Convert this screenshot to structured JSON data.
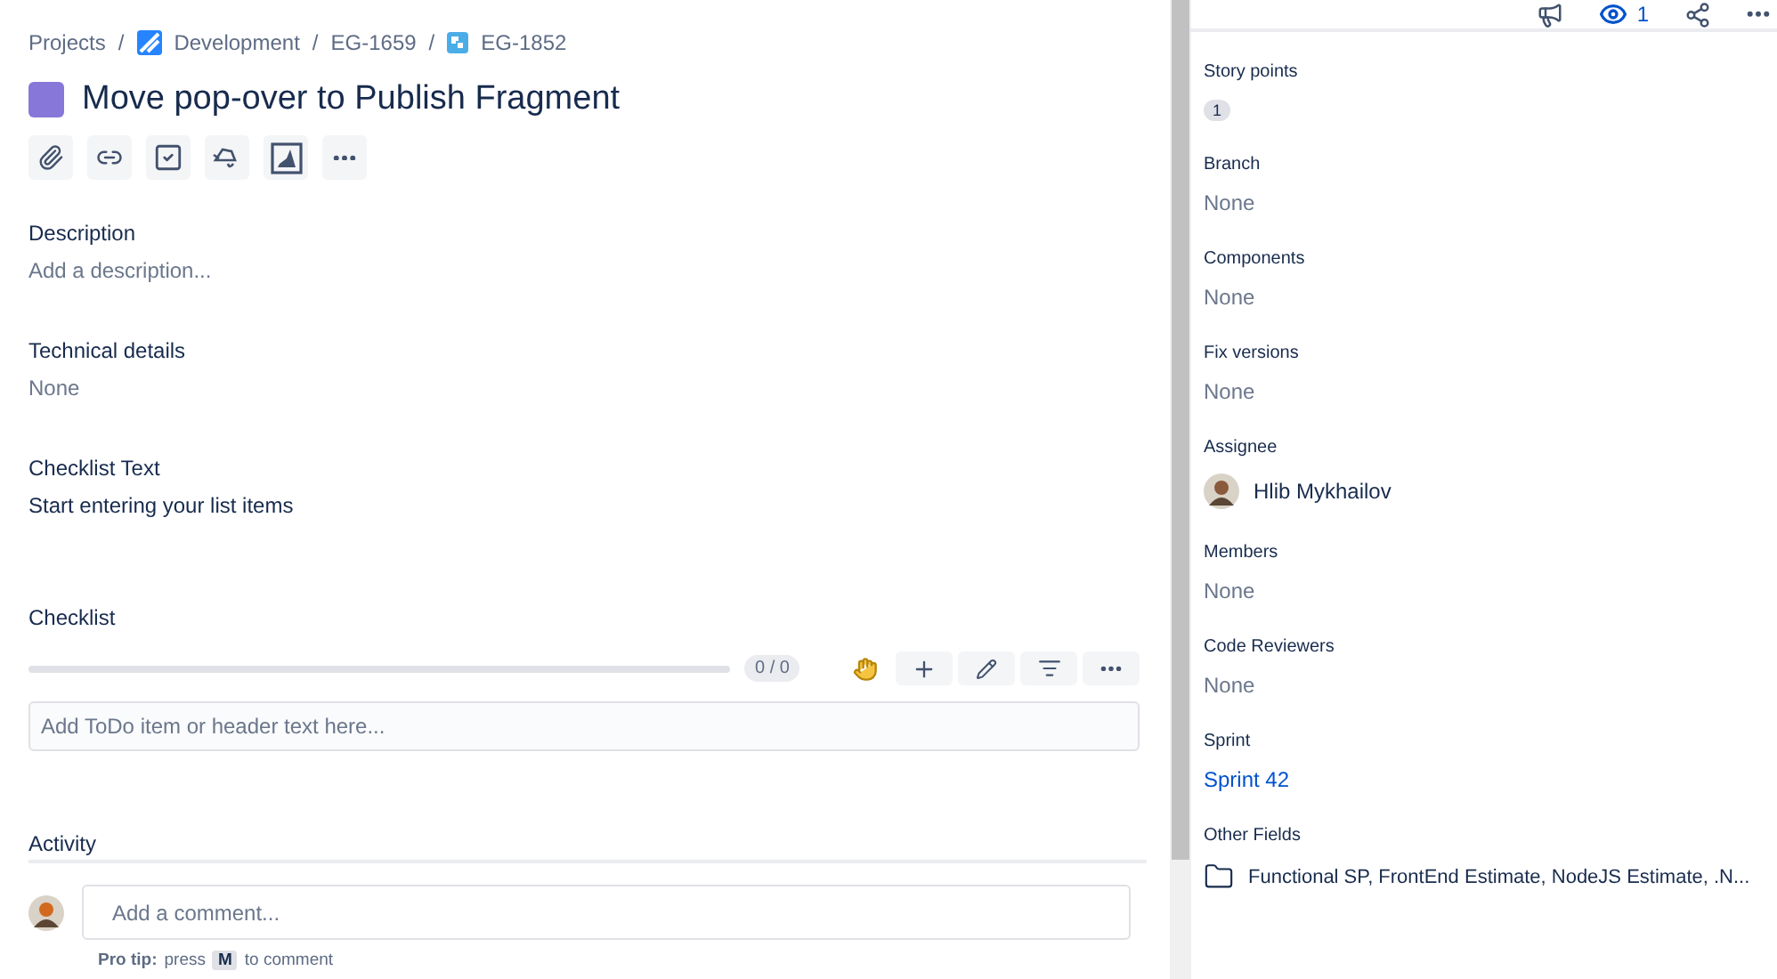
{
  "breadcrumbs": [
    {
      "label": "Projects",
      "kind": "text"
    },
    {
      "label": "Development",
      "kind": "project"
    },
    {
      "label": "EG-1659",
      "kind": "text"
    },
    {
      "label": "EG-1852",
      "kind": "issue"
    }
  ],
  "separator": "/",
  "issue": {
    "title": "Move pop-over to Publish Fragment"
  },
  "sections": [
    {
      "heading": "Description",
      "value": "Add a description...",
      "empty": true
    },
    {
      "heading": "Technical details",
      "value": "None",
      "empty": true
    },
    {
      "heading": "Checklist Text",
      "value": "Start entering your list items",
      "empty": false
    }
  ],
  "checklist": {
    "heading": "Checklist",
    "level": 0,
    "reading": "0 / 0",
    "placeholder": "Add ToDo item or header text here..."
  },
  "activity": {
    "heading": "Activity",
    "comment_placeholder": "Add a comment...",
    "tip_label": "Pro tip:",
    "tip_before": "press",
    "tip_key": "M",
    "tip_after": "to comment"
  },
  "header": {
    "watchers": "1"
  },
  "fields": [
    {
      "label": "Story points",
      "kind": "badge",
      "value": "1"
    },
    {
      "label": "Branch",
      "kind": "empty",
      "value": "None"
    },
    {
      "label": "Components",
      "kind": "empty",
      "value": "None"
    },
    {
      "label": "Fix versions",
      "kind": "empty",
      "value": "None"
    },
    {
      "label": "Assignee",
      "kind": "user",
      "value": "Hlib Mykhailov"
    },
    {
      "label": "Members",
      "kind": "empty",
      "value": "None"
    },
    {
      "label": "Code Reviewers",
      "kind": "empty",
      "value": "None"
    },
    {
      "label": "Sprint",
      "kind": "link",
      "value": "Sprint 42"
    },
    {
      "label": "Other Fields",
      "kind": "folder",
      "value": "Functional SP, FrontEnd Estimate, NodeJS Estimate, .N..."
    }
  ]
}
